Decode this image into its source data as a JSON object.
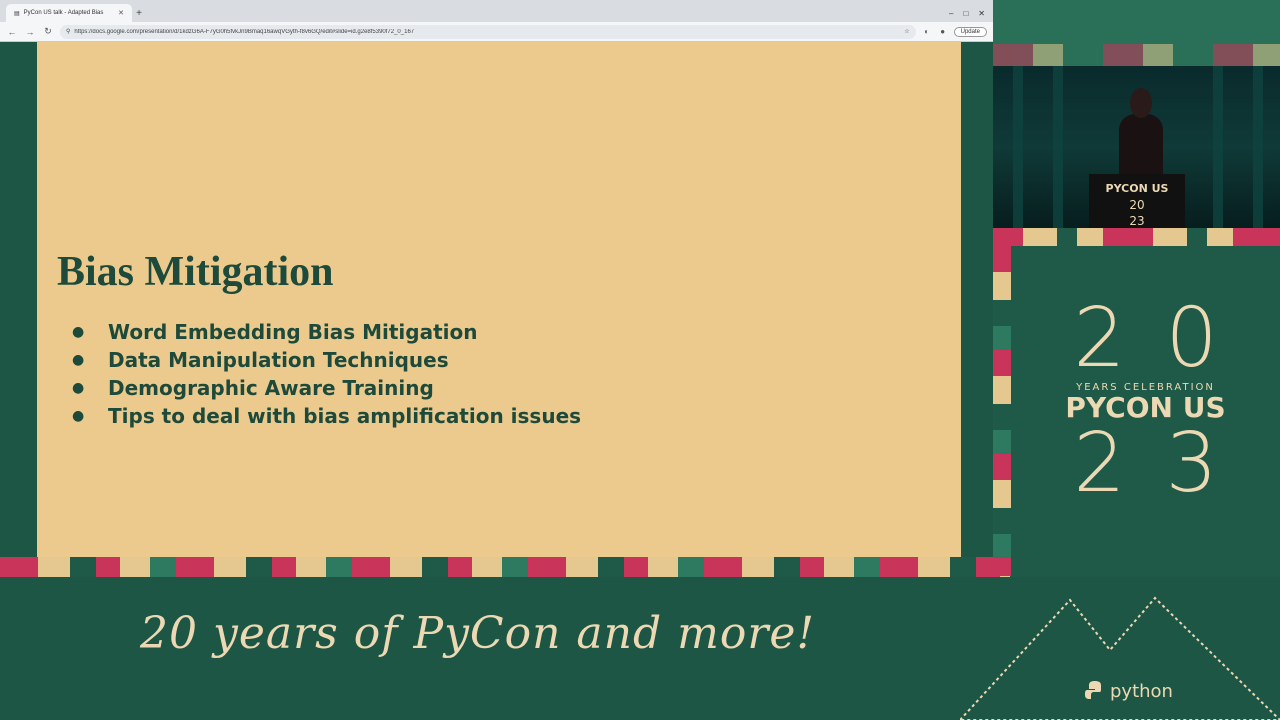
{
  "browser": {
    "tab_title": "PyCon US talk - Adapted Bias",
    "new_tab": "+",
    "url": "https://docs.google.com/presentation/d/1kdzG6A-F7yG0h5fvkJn9Bmaq16awqVGyth-f8v6GQ/edit#slide=id.g2e8f5390f72_0_167",
    "update_label": "Update",
    "win_min": "–",
    "win_max": "□",
    "win_close": "✕"
  },
  "slide": {
    "title": "Bias Mitigation",
    "bullet_symbol": "●",
    "bullets": [
      "Word Embedding Bias Mitigation",
      "Data Manipulation Techniques",
      "Demographic Aware Training",
      "Tips to deal with bias amplification issues"
    ]
  },
  "podium": {
    "logo": "PYCON US",
    "year_top": "20",
    "year_bottom": "23"
  },
  "brand": {
    "num_top": "20",
    "tag": "YEARS CELEBRATION",
    "logo": "PYCON US",
    "num_bottom": "23"
  },
  "footer": {
    "tagline": "20 years of PyCon and more!",
    "python_logo": "python"
  },
  "colors": {
    "slide_bg": "#ecca8e",
    "dark_green": "#1f5a48",
    "accent_pink": "#c9355a",
    "cream": "#ecd9b4"
  }
}
